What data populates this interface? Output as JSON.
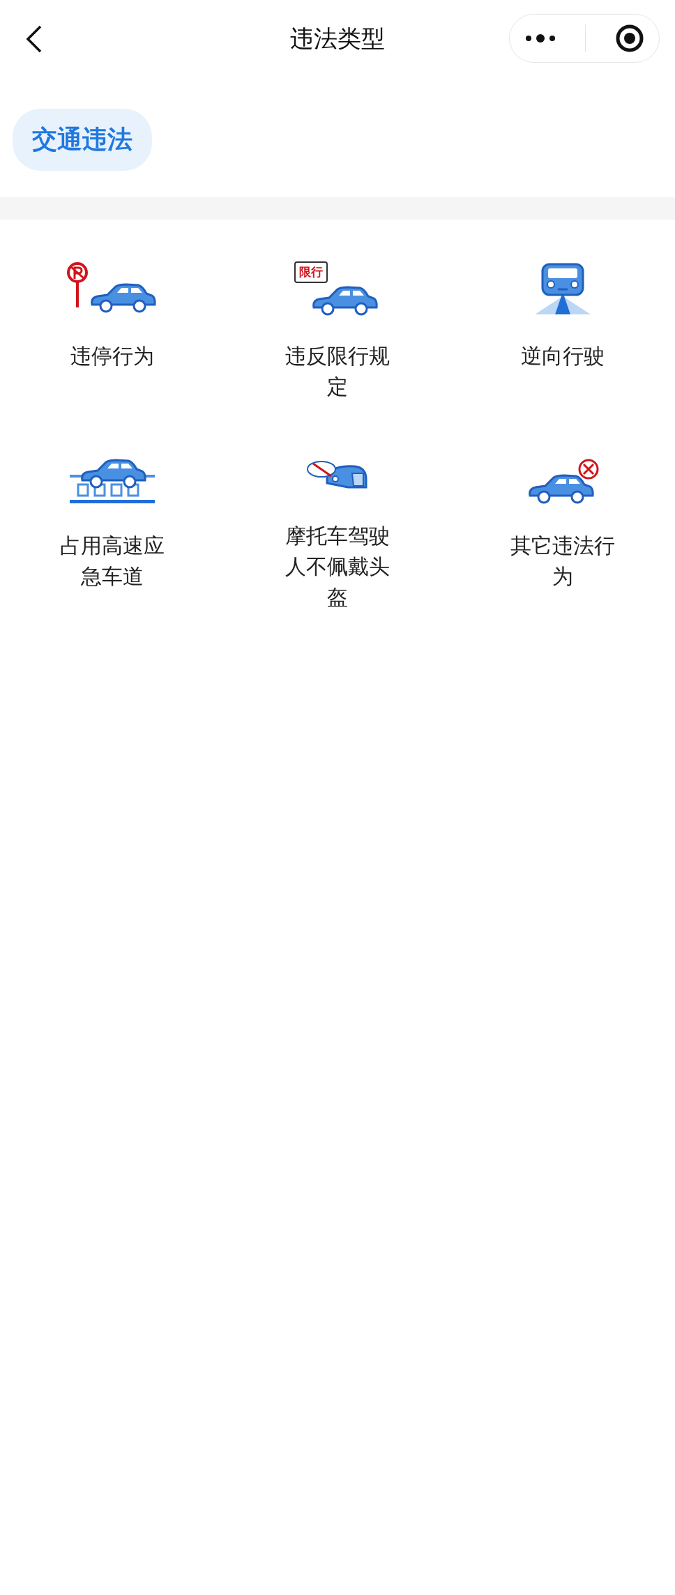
{
  "nav": {
    "title": "违法类型"
  },
  "tabs": [
    {
      "label": "交通违法",
      "selected": true
    }
  ],
  "categories": [
    {
      "kind": "parking",
      "label": "违停行为"
    },
    {
      "kind": "restriction",
      "label": "违反限行规定",
      "sign": "限行"
    },
    {
      "kind": "wrong-way",
      "label": "逆向行驶"
    },
    {
      "kind": "emergency-lane",
      "label": "占用高速应急车道"
    },
    {
      "kind": "helmet",
      "label": "摩托车驾驶人不佩戴头盔"
    },
    {
      "kind": "other",
      "label": "其它违法行为"
    }
  ]
}
